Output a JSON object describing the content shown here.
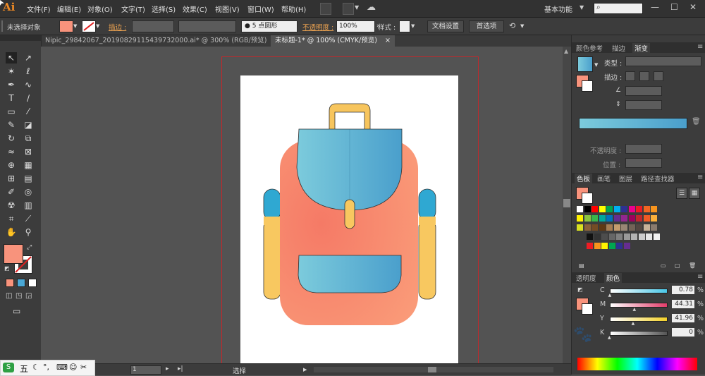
{
  "app": {
    "logo": "Ai",
    "workspace": "基本功能"
  },
  "menu": [
    "文件(F)",
    "编辑(E)",
    "对象(O)",
    "文字(T)",
    "选择(S)",
    "效果(C)",
    "视图(V)",
    "窗口(W)",
    "帮助(H)"
  ],
  "control": {
    "selection_label": "未选择对象",
    "stroke_label": "描边 :",
    "brush_label": "5 点圆形",
    "opacity_label": "不透明度 :",
    "opacity_value": "100%",
    "style_label": "样式 :",
    "doc_setup": "文档设置",
    "prefs": "首选项"
  },
  "tabs": [
    {
      "label": "Nipic_29842067_20190829115439732000.ai* @ 300% (RGB/预览)",
      "close": "×"
    },
    {
      "label": "未标题-1* @ 100% (CMYK/预览)",
      "close": "×"
    }
  ],
  "panels": {
    "gradient_tabs": [
      "颜色参考",
      "描边",
      "渐变"
    ],
    "type_label": "类型 :",
    "stroke_label": "描边 :",
    "opacity_label": "不透明度 :",
    "position_label": "位置 :",
    "swatch_tabs": [
      "色板",
      "画笔",
      "图层",
      "路径查找器"
    ],
    "color_tabs": [
      "透明度",
      "颜色"
    ],
    "cmyk": [
      {
        "channel": "C",
        "value": "0.78",
        "unit": "%",
        "level": 0.0078
      },
      {
        "channel": "M",
        "value": "44.31",
        "unit": "%",
        "level": 0.4431
      },
      {
        "channel": "Y",
        "value": "41.96",
        "unit": "%",
        "level": 0.4196
      },
      {
        "channel": "K",
        "value": "0",
        "unit": "%",
        "level": 0
      }
    ]
  },
  "status": {
    "zoom_value": "1",
    "mode": "选择"
  },
  "ime": {
    "label": "五"
  },
  "colors": {
    "bag_body": "#f88870",
    "bag_flap_light": "#7ccbdc",
    "bag_flap_dark": "#4a9fcc",
    "handle": "#f7c55d",
    "strap_blue": "#2fa8d2",
    "strap_yellow": "#f8c860",
    "fill_swatch": "#f8937c"
  }
}
